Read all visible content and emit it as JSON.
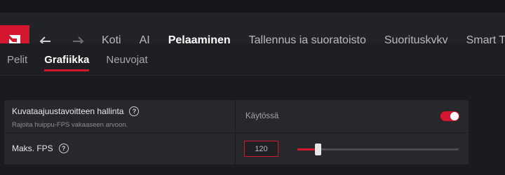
{
  "nav": {
    "tabs": [
      {
        "label": "Koti"
      },
      {
        "label": "AI"
      },
      {
        "label": "Pelaaminen"
      },
      {
        "label": "Tallennus ja suoratoisto"
      },
      {
        "label": "Suorituskyky"
      },
      {
        "label": "Smart Te"
      }
    ],
    "active_index": 2
  },
  "subnav": {
    "tabs": [
      {
        "label": "Pelit"
      },
      {
        "label": "Grafiikka"
      },
      {
        "label": "Neuvojat"
      }
    ],
    "active_index": 1
  },
  "settings": {
    "frame_rate_target": {
      "title": "Kuvataajuustavoitteen hallinta",
      "description": "Rajoita huippu-FPS vakaaseen arvoon.",
      "status": "Käytössä",
      "enabled": true
    },
    "max_fps": {
      "title": "Maks. FPS",
      "value": "120",
      "slider_fraction": 0.13
    }
  },
  "colors": {
    "accent": "#d4172f",
    "background": "#1a1b1e",
    "panel": "#27282b"
  },
  "icons": {
    "logo": "amd-logo-icon",
    "back": "arrow-left-icon",
    "forward": "arrow-right-icon",
    "help": "question-circle-icon"
  }
}
